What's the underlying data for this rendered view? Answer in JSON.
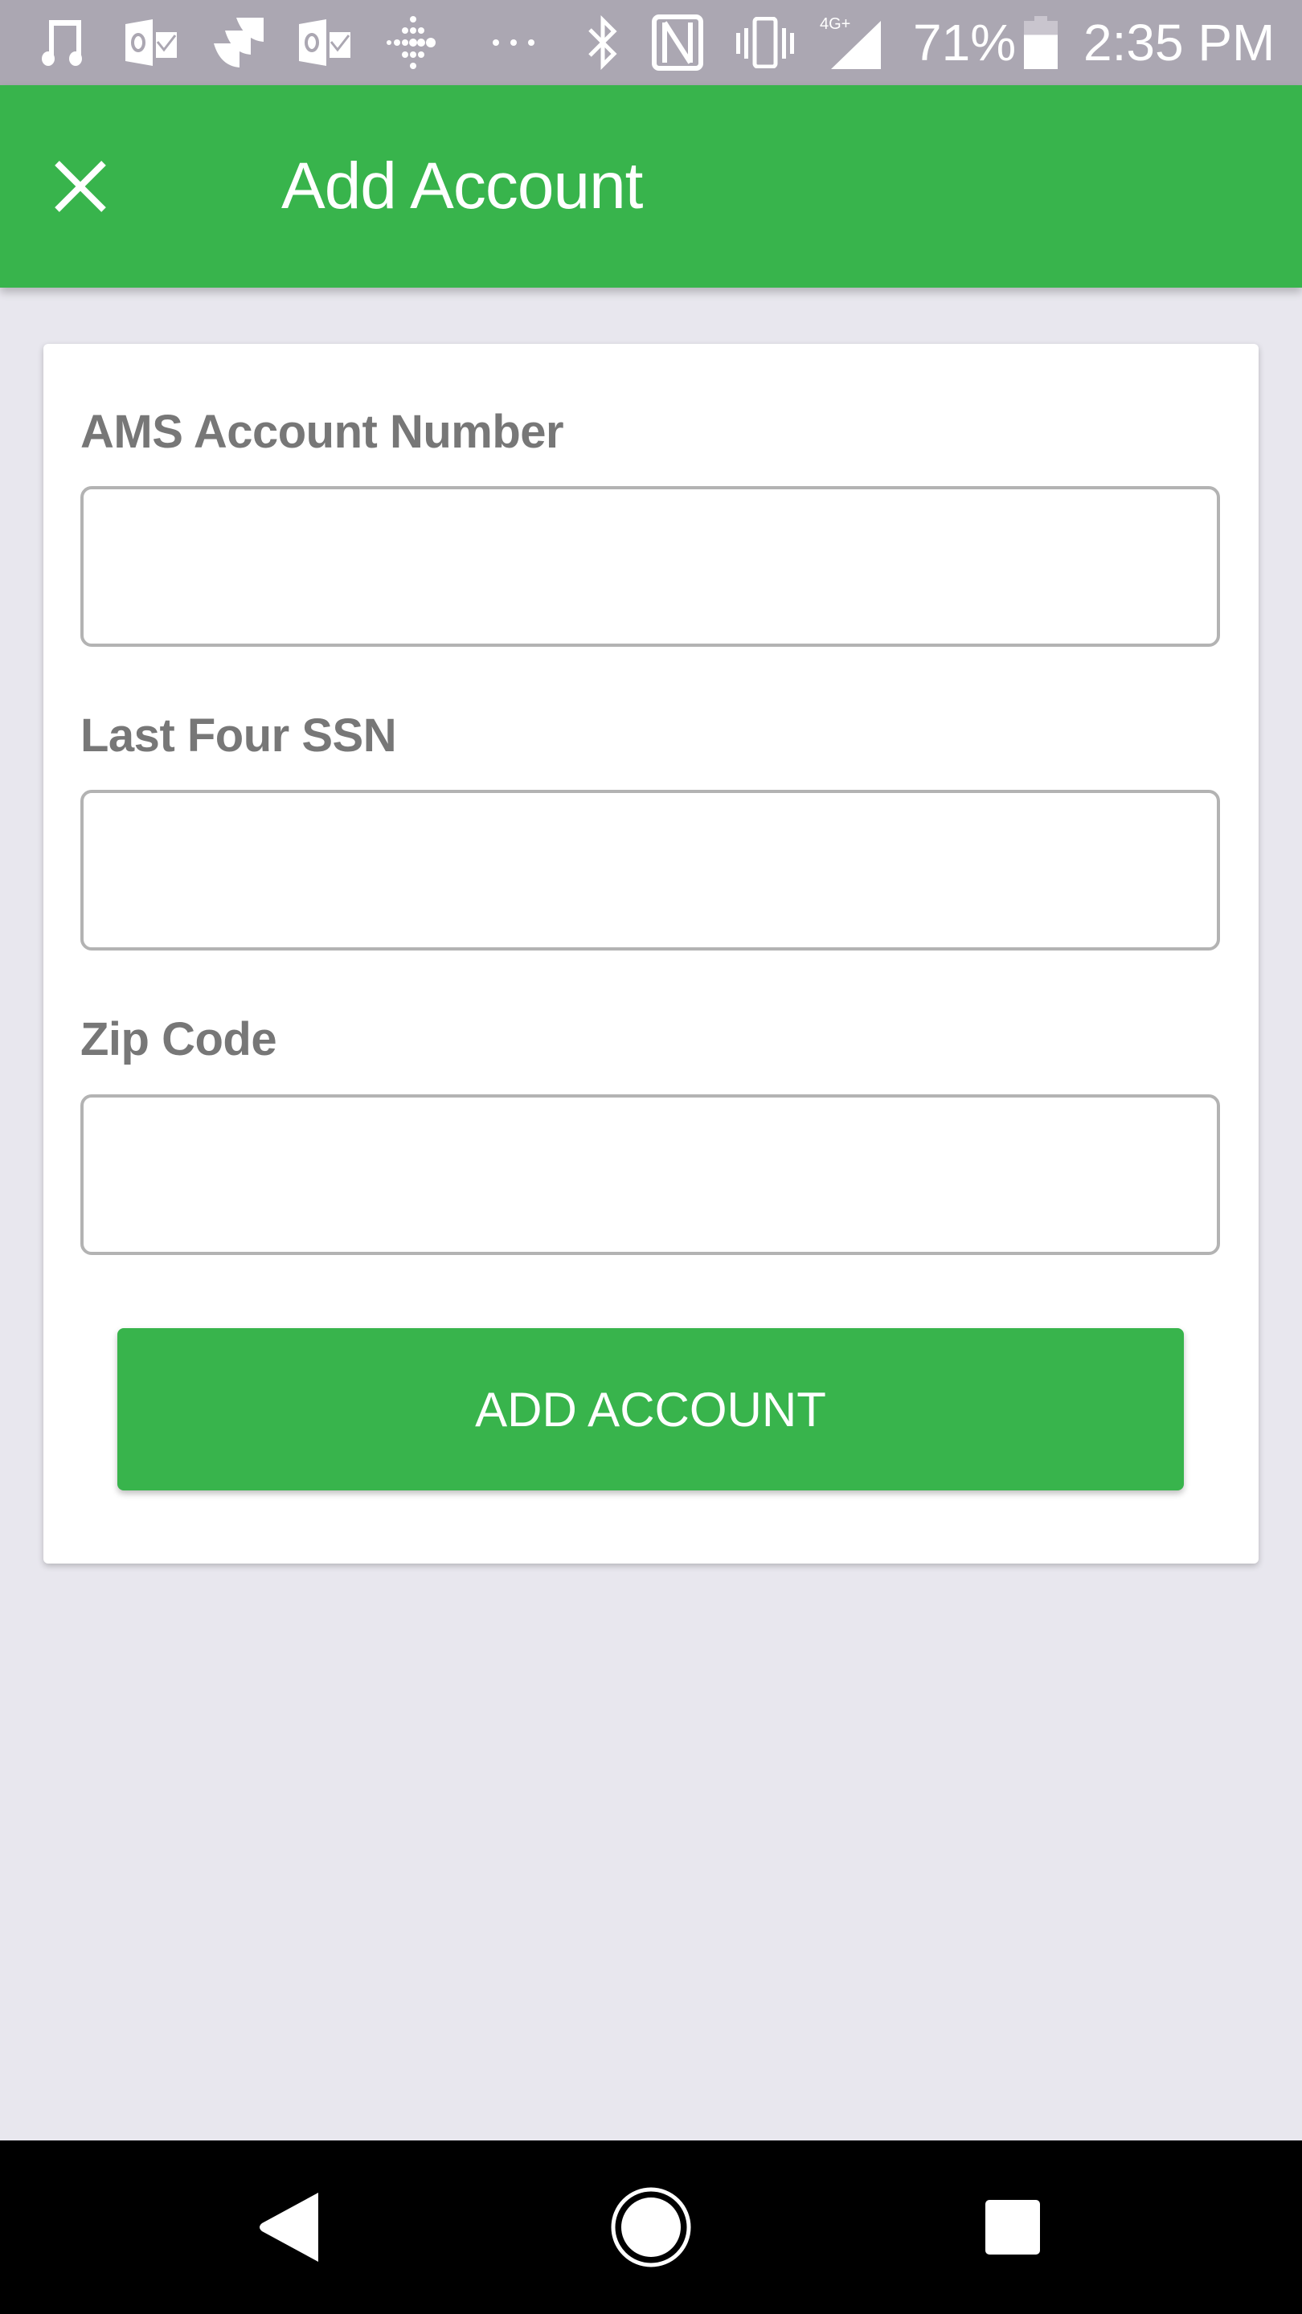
{
  "status_bar": {
    "notification_icons": [
      "music-note-icon",
      "outlook-icon",
      "jira-icon",
      "outlook-icon",
      "fitbit-icon",
      "more-notifications-icon"
    ],
    "system_icons": [
      "bluetooth-icon",
      "nfc-icon",
      "vibrate-icon",
      "signal-4g-plus-icon"
    ],
    "network_label": "4G+",
    "battery_percent": "71%",
    "battery_level": 0.71,
    "time": "2:35 PM"
  },
  "app_bar": {
    "title": "Add Account",
    "close_icon": "close-icon"
  },
  "form": {
    "fields": [
      {
        "label": "AMS Account Number",
        "value": "",
        "placeholder": ""
      },
      {
        "label": "Last Four SSN",
        "value": "",
        "placeholder": ""
      },
      {
        "label": "Zip Code",
        "value": "",
        "placeholder": ""
      }
    ],
    "submit_label": "ADD ACCOUNT"
  },
  "nav_bar": {
    "buttons": [
      "back-icon",
      "home-icon",
      "recents-icon"
    ]
  },
  "colors": {
    "primary": "#38B44C",
    "status_bar": "#ABA7B2",
    "background": "#E8E7EE",
    "label": "#777777",
    "input_border": "#B3B3B3"
  }
}
